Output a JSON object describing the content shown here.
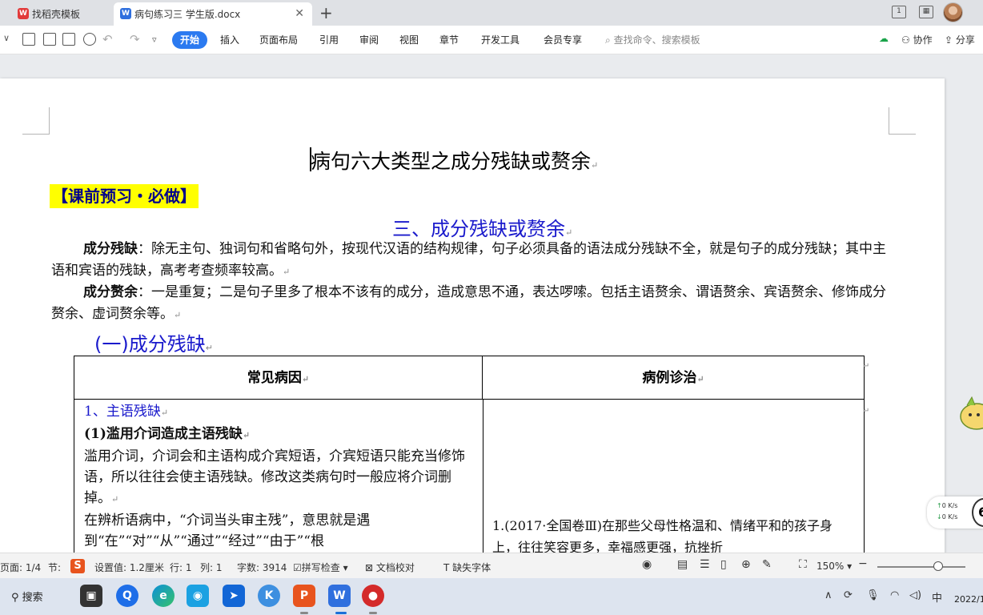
{
  "tabs": [
    {
      "label": "找稻壳模板",
      "icon": "wps-docer-icon"
    },
    {
      "label": "病句练习三 学生版.docx",
      "icon": "wps-writer-icon",
      "active": true
    }
  ],
  "ribbon": {
    "active_menu": "开始",
    "menus": [
      "插入",
      "页面布局",
      "引用",
      "审阅",
      "视图",
      "章节",
      "开发工具",
      "会员专享"
    ],
    "search_placeholder": "查找命令、搜索模板",
    "collab": "协作",
    "share": "分享"
  },
  "document": {
    "title": "病句六大类型之成分残缺或赘余",
    "preview_tag": "【课前预习・必做】",
    "section_heading": "三、成分残缺或赘余",
    "para1_term": "成分残缺",
    "para1_text": "：除无主句、独词句和省略句外，按现代汉语的结构规律，句子必须具备的语法成分残缺不全，就是句子的成分残缺；其中主语和宾语的残缺，高考考查频率较高。",
    "para2_term": "成分赘余",
    "para2_text": "：一是重复；二是句子里多了根本不该有的成分，造成意思不通，表达啰嗦。包括主语赘余、谓语赘余、宾语赘余、修饰成分赘余、虚词赘余等。",
    "sub_heading": "(一)成分残缺",
    "table": {
      "col1_header": "常见病因",
      "col2_header": "病例诊治",
      "left_heading": "1、主语残缺",
      "left_subheading": "(1)滥用介词造成主语残缺",
      "left_p1": "滥用介词，介词会和主语构成介宾短语，介宾短语只能充当修饰语，所以往往会使主语残缺。修改这类病句时一般应将介词删掉。",
      "left_p2": "在辨析语病中，“介词当头审主残”，意思就是遇到“在”“对”“从”“通过”“经过”“由于”“根",
      "right_p1": "1.(2017·全国卷Ⅲ)在那些父母性格温和、情绪平和的孩子身上，往往笑容更多，幸福感更强，抗挫折"
    }
  },
  "status_bar": {
    "page": "页面: 1/4",
    "section": "节:",
    "setting": "设置值: 1.2厘米",
    "row": "行: 1",
    "col": "列: 1",
    "word_count": "字数: 3914",
    "spell_check": "拼写检查",
    "proofread": "文档校对",
    "missing_font": "缺失字体",
    "zoom": "150%"
  },
  "network": {
    "up": "0 K/s",
    "down": "0 K/s",
    "badge": "6"
  },
  "taskbar": {
    "search": "搜索",
    "clock": "2022/1"
  }
}
